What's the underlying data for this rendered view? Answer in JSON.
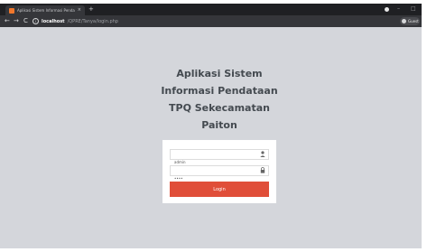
{
  "browser": {
    "tab_title": "Aplikasi Sistem Informasi Penda",
    "tab_close": "×",
    "new_tab": "+",
    "back": "←",
    "forward": "→",
    "reload": "C",
    "info": "i",
    "url_host": "localhost",
    "url_path": "/QPRE/Tanya/login.php",
    "profile_label": "Guest"
  },
  "page": {
    "title_lines": [
      "Aplikasi Sistem",
      "Informasi Pendataan",
      "TPQ Sekecamatan",
      "Paiton"
    ]
  },
  "login": {
    "username_value": "admin",
    "password_value": "••••",
    "user_icon": "user-icon",
    "lock_icon": "lock-icon",
    "button_label": "Login"
  },
  "colors": {
    "page_bg": "#d4d6db",
    "chrome_dark": "#1f2023",
    "toolbar": "#35363a",
    "login_button": "#e04e39",
    "favicon": "#f0772c"
  }
}
